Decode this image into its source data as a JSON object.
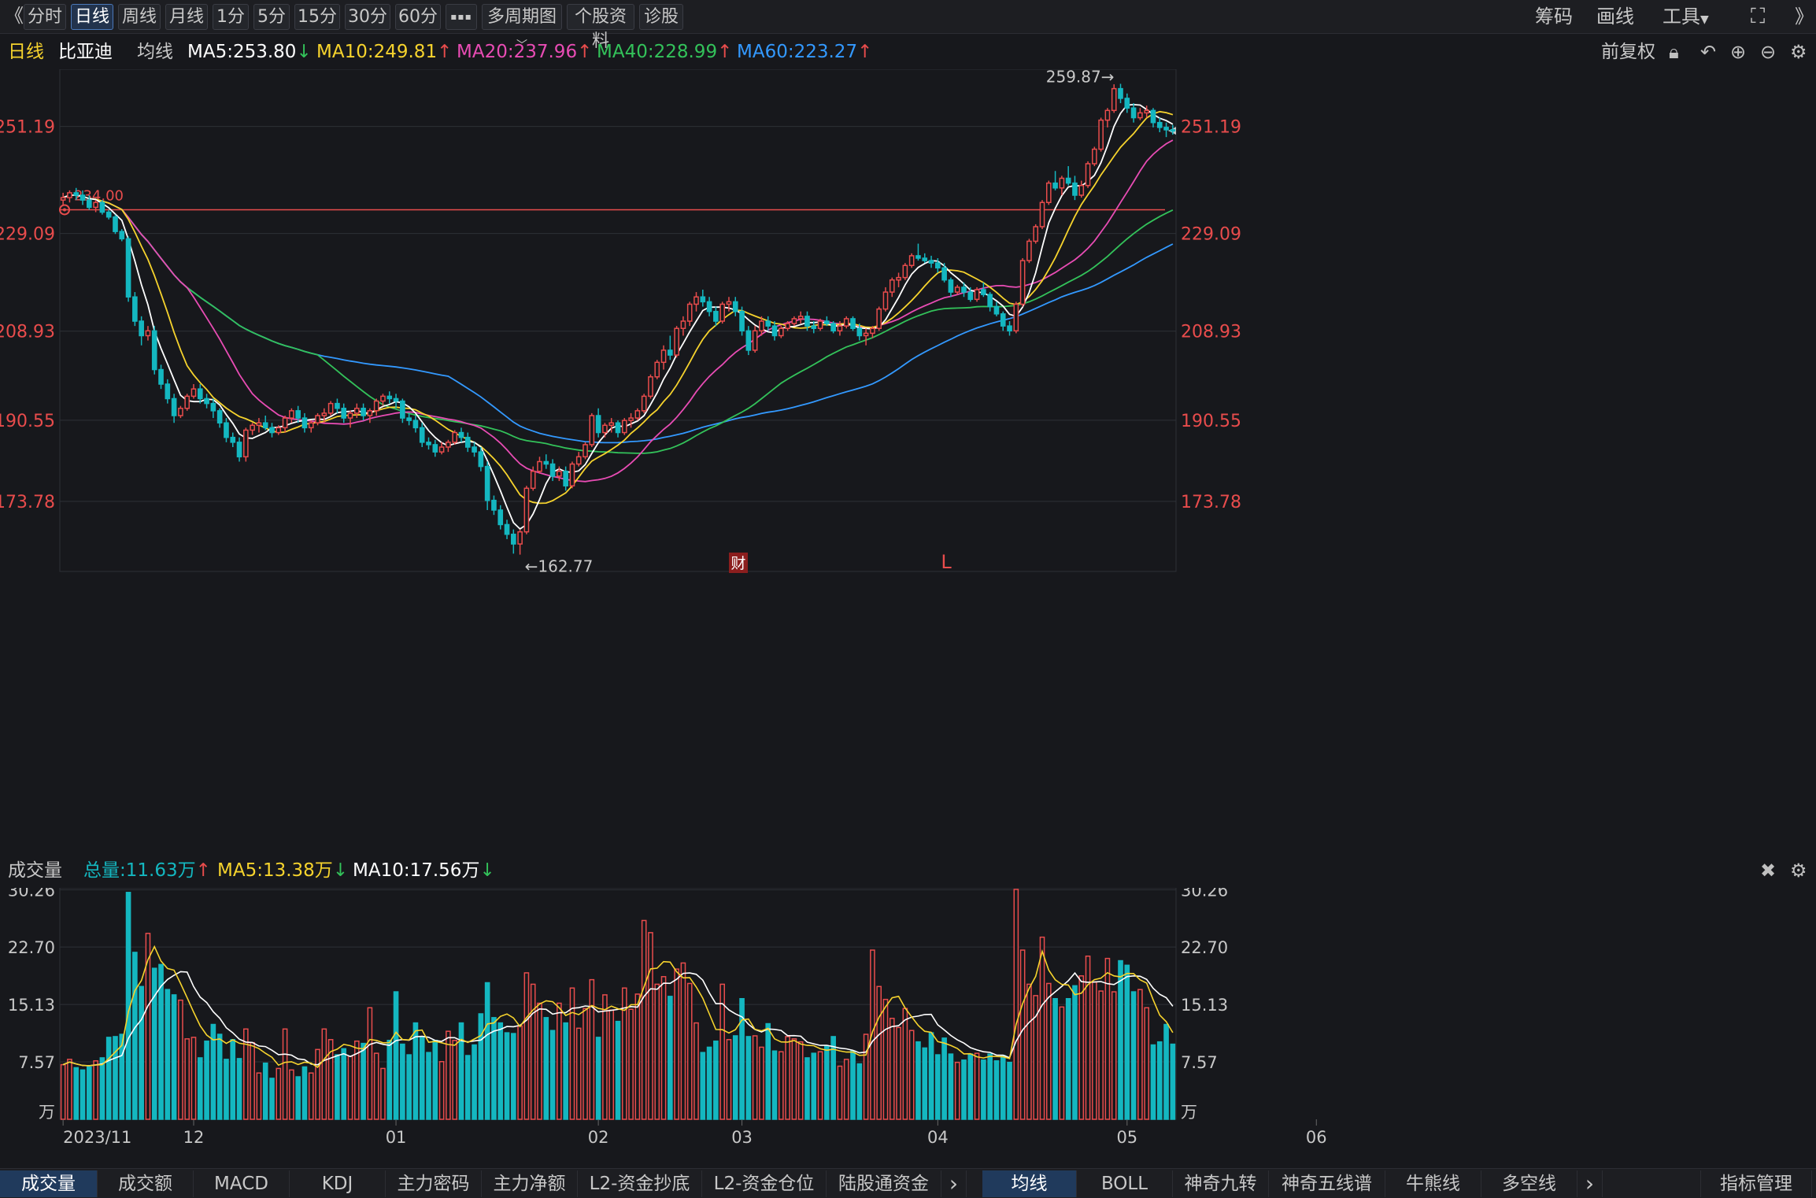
{
  "topbar": {
    "back": "《",
    "tabs": [
      "分时",
      "日线",
      "周线",
      "月线",
      "1分",
      "5分",
      "15分",
      "30分",
      "60分"
    ],
    "more": "▪▪▪",
    "multi_period": "多周期图",
    "stock_info": "个股资料",
    "diagnose": "诊股",
    "chips": "筹码",
    "draw": "画线",
    "tools": "工具"
  },
  "info": {
    "period": "日线",
    "stock": "比亚迪",
    "ma_label": "均线",
    "ma5": "MA5:253.80",
    "ma10": "MA10:249.81",
    "ma20": "MA20:237.96",
    "ma40": "MA40:228.99",
    "ma60": "MA60:223.27",
    "adjust": "前复权"
  },
  "volume_info": {
    "title": "成交量",
    "total": "总量:11.63万",
    "ma5": "MA5:13.38万",
    "ma10": "MA10:17.56万"
  },
  "annotations": {
    "high": "259.87→",
    "low": "←162.77",
    "ref": "234.00",
    "fin": "财",
    "l_mark": "L"
  },
  "colors": {
    "up": "#e84c4c",
    "down": "#14b7c0",
    "ma5": "#ffffff",
    "ma10": "#f6d32d",
    "ma20": "#e84cb4",
    "ma40": "#33c25a",
    "ma60": "#3399ff",
    "ref": "#e84c4c"
  },
  "bottombar": {
    "left": [
      "成交量",
      "成交额",
      "MACD",
      "KDJ",
      "主力密码",
      "主力净额",
      "L2-资金抄底",
      "L2-资金仓位",
      "陆股通资金"
    ],
    "right": [
      "均线",
      "BOLL",
      "神奇九转",
      "神奇五线谱",
      "牛熊线",
      "多空线"
    ],
    "manage": "指标管理",
    "arrow": "›"
  },
  "chart_data": {
    "type": "candlestick",
    "price_axis": {
      "ticks": [
        "251.19",
        "229.09",
        "208.93",
        "190.55",
        "173.78"
      ],
      "range": [
        159,
        263
      ]
    },
    "volume_axis": {
      "ticks": [
        "30.26",
        "22.70",
        "15.13",
        "7.57"
      ],
      "unit": "万",
      "range": [
        0,
        30.5
      ]
    },
    "x_ticks": [
      {
        "i": 0,
        "label": "2023/11"
      },
      {
        "i": 20,
        "label": "12"
      },
      {
        "i": 51,
        "label": "01"
      },
      {
        "i": 82,
        "label": "02"
      },
      {
        "i": 104,
        "label": "03"
      },
      {
        "i": 134,
        "label": "04"
      },
      {
        "i": 163,
        "label": "05"
      },
      {
        "i": 192,
        "label": "06"
      }
    ],
    "reference_price": 234.0,
    "candles": [
      [
        236,
        237.5,
        235,
        236.5,
        7.2
      ],
      [
        236.5,
        238,
        235.5,
        237.5,
        7.9
      ],
      [
        237.5,
        238.5,
        236,
        237,
        6.8
      ],
      [
        237,
        238,
        235,
        236,
        6.5
      ],
      [
        236,
        237,
        234,
        234.5,
        6.9
      ],
      [
        234.5,
        236,
        233.5,
        235.5,
        7.7
      ],
      [
        235.5,
        236,
        233,
        233.5,
        8.1
      ],
      [
        233.5,
        234,
        232,
        232.5,
        10.8
      ],
      [
        232.5,
        233,
        229,
        229.5,
        10.9
      ],
      [
        229.5,
        230,
        227.5,
        228,
        11.2
      ],
      [
        228,
        228.5,
        215,
        216,
        29.9
      ],
      [
        216,
        217,
        210,
        211,
        22.0
      ],
      [
        211,
        212,
        206,
        208,
        17.5
      ],
      [
        208,
        210,
        207,
        209,
        24.5
      ],
      [
        209,
        210,
        200,
        201,
        19.9
      ],
      [
        201,
        202,
        197,
        198,
        20.4
      ],
      [
        198,
        199,
        194,
        195,
        17.1
      ],
      [
        195,
        196,
        190,
        191.5,
        16.4
      ],
      [
        191.5,
        193.5,
        191,
        193,
        15.7
      ],
      [
        193,
        196,
        192.5,
        195.5,
        10.6
      ],
      [
        195.5,
        198,
        195,
        197,
        10.8
      ],
      [
        197,
        198,
        194,
        195,
        8.1
      ],
      [
        195,
        196,
        193,
        194,
        10.3
      ],
      [
        194,
        195,
        191,
        192.5,
        12.5
      ],
      [
        192.5,
        193,
        189,
        190,
        11.2
      ],
      [
        190,
        191,
        186,
        187,
        7.9
      ],
      [
        187,
        188,
        185,
        186,
        10.5
      ],
      [
        186,
        187,
        182,
        183,
        8.0
      ],
      [
        183,
        189,
        182,
        188.5,
        11.9
      ],
      [
        188.5,
        190,
        187.5,
        189.5,
        10.1
      ],
      [
        189.5,
        191,
        188,
        190,
        6.1
      ],
      [
        190,
        191.5,
        188.5,
        189,
        7.4
      ],
      [
        189,
        190,
        187,
        188,
        5.4
      ],
      [
        188,
        189.5,
        187.5,
        189,
        6.7
      ],
      [
        189,
        191.5,
        188,
        191,
        11.9
      ],
      [
        191,
        193,
        190,
        192.5,
        6.5
      ],
      [
        192.5,
        193.5,
        190,
        191,
        5.6
      ],
      [
        191,
        192,
        188,
        189,
        6.9
      ],
      [
        189,
        190.5,
        188,
        190,
        6.1
      ],
      [
        190,
        192,
        189.5,
        191.5,
        9.2
      ],
      [
        191.5,
        193,
        190,
        192,
        11.9
      ],
      [
        192,
        194.5,
        191.5,
        194,
        10.5
      ],
      [
        194,
        195,
        192,
        193,
        8.5
      ],
      [
        193,
        194,
        190,
        191,
        9.3
      ],
      [
        191,
        192.5,
        189,
        192,
        8.3
      ],
      [
        192,
        194,
        191,
        193,
        10.3
      ],
      [
        193,
        194,
        190.5,
        191.5,
        10.0
      ],
      [
        191.5,
        193,
        190,
        192.5,
        14.7
      ],
      [
        192.5,
        195,
        191.5,
        194.5,
        8.7
      ],
      [
        194.5,
        196,
        193.5,
        195.5,
        6.7
      ],
      [
        195.5,
        196.5,
        194,
        195,
        10.4
      ],
      [
        195,
        196,
        193,
        194.5,
        16.8
      ],
      [
        194.5,
        195,
        190,
        191,
        9.9
      ],
      [
        191,
        192,
        189.5,
        190.5,
        8.5
      ],
      [
        190.5,
        191.5,
        188,
        189,
        12.7
      ],
      [
        189,
        190,
        185,
        186,
        10.9
      ],
      [
        186,
        187,
        184.5,
        185.5,
        8.8
      ],
      [
        185.5,
        186.5,
        183,
        184,
        10.4
      ],
      [
        184,
        186,
        183.5,
        185,
        7.6
      ],
      [
        185,
        186.5,
        184,
        186,
        11.6
      ],
      [
        186,
        188.5,
        185.5,
        188,
        10.4
      ],
      [
        188,
        189,
        186,
        187,
        12.7
      ],
      [
        187,
        188,
        184,
        185,
        8.4
      ],
      [
        185,
        186,
        183,
        184,
        9.8
      ],
      [
        184,
        185,
        180,
        181,
        13.9
      ],
      [
        181,
        182,
        172,
        174,
        18.0
      ],
      [
        174,
        175,
        171,
        172,
        13.4
      ],
      [
        172,
        173,
        168,
        169,
        12.7
      ],
      [
        169,
        170,
        166,
        167,
        11.4
      ],
      [
        167,
        168,
        163,
        165,
        11.3
      ],
      [
        165,
        168,
        162.8,
        167.5,
        12.3
      ],
      [
        167.5,
        177,
        167,
        176.5,
        19.3
      ],
      [
        176.5,
        181,
        176,
        180,
        17.8
      ],
      [
        180,
        183,
        179.5,
        182,
        15.3
      ],
      [
        182,
        183.5,
        180.5,
        181.5,
        13.4
      ],
      [
        181.5,
        182.5,
        178,
        179,
        11.7
      ],
      [
        179,
        181,
        178,
        180,
        15.3
      ],
      [
        180,
        181,
        176,
        177,
        12.7
      ],
      [
        177,
        182,
        176.5,
        181.5,
        17.3
      ],
      [
        181.5,
        184,
        181,
        183,
        12.0
      ],
      [
        183,
        186,
        182.5,
        185.5,
        14.6
      ],
      [
        185.5,
        192,
        185,
        191.5,
        18.4
      ],
      [
        191.5,
        193,
        187,
        188,
        10.8
      ],
      [
        188,
        190,
        187,
        189.5,
        16.4
      ],
      [
        189.5,
        191,
        188,
        190,
        14.4
      ],
      [
        190,
        190.5,
        187,
        188,
        12.9
      ],
      [
        188,
        191,
        187.5,
        190.5,
        17.3
      ],
      [
        190.5,
        192,
        189,
        191,
        14.5
      ],
      [
        191,
        193,
        190.5,
        192.5,
        16.5
      ],
      [
        192.5,
        196,
        192,
        195.5,
        26.2
      ],
      [
        195.5,
        200,
        195,
        199.5,
        24.6
      ],
      [
        199.5,
        203,
        199,
        202.5,
        17.8
      ],
      [
        202.5,
        206,
        201,
        205,
        18.8
      ],
      [
        205,
        208,
        203,
        204,
        16.2
      ],
      [
        204,
        210,
        203.5,
        209.5,
        19.8
      ],
      [
        209.5,
        212,
        208,
        211,
        20.6
      ],
      [
        211,
        215,
        210,
        214.5,
        17.9
      ],
      [
        214.5,
        217,
        213,
        216,
        12.7
      ],
      [
        216,
        217.5,
        214,
        215,
        8.8
      ],
      [
        215,
        216,
        212,
        213,
        9.5
      ],
      [
        213,
        214,
        210,
        211,
        10.3
      ],
      [
        211,
        215,
        210.5,
        214.5,
        17.8
      ],
      [
        214.5,
        216,
        213,
        215,
        10.5
      ],
      [
        215,
        216,
        212,
        213,
        11.0
      ],
      [
        213,
        214,
        208,
        209,
        15.9
      ],
      [
        209,
        210,
        204,
        205,
        10.9
      ],
      [
        205,
        210,
        204.5,
        209,
        11.0
      ],
      [
        209,
        212,
        208,
        211,
        9.5
      ],
      [
        211,
        212,
        209,
        210,
        12.6
      ],
      [
        210,
        211,
        207,
        208,
        9.0
      ],
      [
        208,
        210,
        207.5,
        209.5,
        8.9
      ],
      [
        209.5,
        211,
        209,
        210.5,
        10.9
      ],
      [
        210.5,
        212,
        210,
        211.5,
        10.6
      ],
      [
        211.5,
        213,
        210.5,
        212,
        10.2
      ],
      [
        212,
        213,
        209,
        210,
        8.1
      ],
      [
        210,
        211,
        208.5,
        209.5,
        8.7
      ],
      [
        209.5,
        211.5,
        209,
        211,
        8.9
      ],
      [
        211,
        212,
        210,
        210.5,
        9.6
      ],
      [
        210.5,
        211,
        208.5,
        209,
        10.9
      ],
      [
        209,
        211,
        208,
        210,
        7.0
      ],
      [
        210,
        212,
        209.5,
        211.5,
        7.9
      ],
      [
        211.5,
        212,
        209,
        209.5,
        9.0
      ],
      [
        209.5,
        210.5,
        207,
        208,
        7.3
      ],
      [
        208,
        209.5,
        206,
        208.5,
        11.2
      ],
      [
        208.5,
        210,
        207.5,
        209.5,
        22.3
      ],
      [
        209.5,
        214,
        209,
        213.5,
        17.5
      ],
      [
        213.5,
        218,
        213,
        217,
        15.8
      ],
      [
        217,
        220,
        216,
        219.5,
        13.3
      ],
      [
        219.5,
        221,
        218,
        220,
        12.1
      ],
      [
        220,
        223,
        219.5,
        222.5,
        14.6
      ],
      [
        222.5,
        225,
        222,
        224.5,
        11.7
      ],
      [
        224.5,
        227,
        223.5,
        224,
        10.2
      ],
      [
        224,
        225,
        223,
        223.5,
        9.4
      ],
      [
        223.5,
        224.5,
        222,
        223,
        11.4
      ],
      [
        223,
        224,
        221,
        222,
        8.5
      ],
      [
        222,
        223,
        219,
        219.5,
        10.7
      ],
      [
        219.5,
        220,
        216,
        217,
        8.6
      ],
      [
        217,
        218.5,
        216.5,
        218,
        7.5
      ],
      [
        218,
        219,
        216,
        217,
        7.8
      ],
      [
        217,
        218,
        215,
        215.5,
        8.6
      ],
      [
        215.5,
        218,
        215,
        217.5,
        8.7
      ],
      [
        217.5,
        219,
        216,
        216.5,
        7.8
      ],
      [
        216.5,
        217,
        213,
        214,
        8.6
      ],
      [
        214,
        215,
        212,
        212.5,
        7.7
      ],
      [
        212.5,
        213,
        209,
        210,
        8.4
      ],
      [
        210,
        211,
        208,
        209,
        7.5
      ],
      [
        209,
        215,
        208.5,
        214.5,
        30.3
      ],
      [
        214.5,
        224,
        214,
        223.5,
        22.3
      ],
      [
        223.5,
        228,
        223,
        227.5,
        17.8
      ],
      [
        227.5,
        231,
        227,
        230.5,
        16.3
      ],
      [
        230.5,
        236,
        230,
        235.5,
        24.0
      ],
      [
        235.5,
        240,
        235,
        239.5,
        17.9
      ],
      [
        239.5,
        242,
        238,
        238.5,
        15.9
      ],
      [
        238.5,
        241,
        237,
        240.5,
        14.8
      ],
      [
        240.5,
        243,
        239,
        239.5,
        15.9
      ],
      [
        239.5,
        241,
        236,
        237,
        17.6
      ],
      [
        237,
        240,
        236.5,
        239,
        18.9
      ],
      [
        239,
        244,
        238.5,
        243.5,
        21.5
      ],
      [
        243.5,
        247,
        243,
        246.5,
        18.1
      ],
      [
        246.5,
        253,
        246,
        252.5,
        16.9
      ],
      [
        252.5,
        255,
        251,
        254.5,
        21.2
      ],
      [
        254.5,
        259.9,
        254,
        259,
        16.8
      ],
      [
        259,
        260,
        256,
        257,
        20.9
      ],
      [
        257,
        258,
        254,
        255,
        20.3
      ],
      [
        255,
        256,
        252,
        253,
        16.8
      ],
      [
        253,
        255,
        252.5,
        254,
        17.1
      ],
      [
        254,
        255.5,
        253,
        254.5,
        14.7
      ],
      [
        254.5,
        255,
        251,
        252,
        9.8
      ],
      [
        252,
        253,
        250,
        251,
        10.2
      ],
      [
        251,
        252,
        249,
        250.5,
        12.5
      ],
      [
        250.5,
        251.5,
        249.5,
        250.3,
        9.9
      ]
    ]
  }
}
